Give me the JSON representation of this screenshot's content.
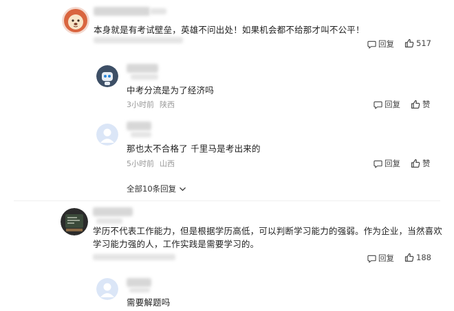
{
  "comments": [
    {
      "text": "本身就是有考试壁垒，英雄不问出处！如果机会都不给那才叫不公平！",
      "reply_label": "回复",
      "like_count": "517",
      "replies": [
        {
          "text": "中考分流是为了经济吗",
          "time": "3小时前",
          "location": "陕西",
          "reply_label": "回复",
          "like_label": "赞"
        },
        {
          "text": "那也太不合格了 千里马是考出来的",
          "time": "5小时前",
          "location": "山西",
          "reply_label": "回复",
          "like_label": "赞"
        }
      ],
      "expand_label": "全部10条回复"
    },
    {
      "text": "学历不代表工作能力，但是根据学历高低，可以判断学习能力的强弱。作为企业，当然喜欢学习能力强的人，工作实践是需要学习的。",
      "reply_label": "回复",
      "like_count": "188",
      "replies": [
        {
          "text": "需要解题吗"
        }
      ]
    }
  ],
  "icons": {
    "reply": "comment-bubble-icon",
    "like": "thumbs-up-icon",
    "expand": "chevron-down-icon"
  }
}
